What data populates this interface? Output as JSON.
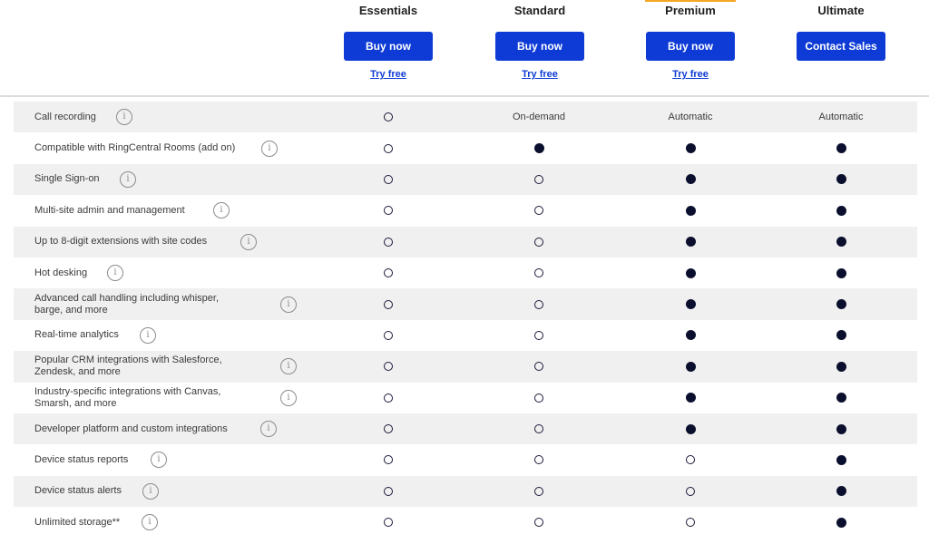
{
  "plans": [
    {
      "name": "Essentials",
      "button": "Buy now",
      "try": "Try free",
      "accent": false
    },
    {
      "name": "Standard",
      "button": "Buy now",
      "try": "Try free",
      "accent": false
    },
    {
      "name": "Premium",
      "button": "Buy now",
      "try": "Try free",
      "accent": true
    },
    {
      "name": "Ultimate",
      "button": "Contact Sales",
      "try": "",
      "accent": false
    }
  ],
  "features": [
    {
      "label": "Call recording",
      "wrap": false,
      "values": [
        "empty",
        "On-demand",
        "Automatic",
        "Automatic"
      ]
    },
    {
      "label": "Compatible with RingCentral Rooms (add on)",
      "wrap": false,
      "values": [
        "empty",
        "full",
        "full",
        "full"
      ]
    },
    {
      "label": "Single Sign-on",
      "wrap": false,
      "values": [
        "empty",
        "empty",
        "full",
        "full"
      ]
    },
    {
      "label": "Multi-site admin and management",
      "wrap": false,
      "values": [
        "empty",
        "empty",
        "full",
        "full"
      ]
    },
    {
      "label": "Up to 8-digit extensions with site codes",
      "wrap": false,
      "values": [
        "empty",
        "empty",
        "full",
        "full"
      ]
    },
    {
      "label": "Hot desking",
      "wrap": false,
      "values": [
        "empty",
        "empty",
        "full",
        "full"
      ]
    },
    {
      "label": "Advanced call handling including whisper, barge, and more",
      "wrap": true,
      "values": [
        "empty",
        "empty",
        "full",
        "full"
      ]
    },
    {
      "label": "Real-time analytics",
      "wrap": false,
      "values": [
        "empty",
        "empty",
        "full",
        "full"
      ]
    },
    {
      "label": "Popular CRM integrations with Salesforce, Zendesk, and more",
      "wrap": true,
      "values": [
        "empty",
        "empty",
        "full",
        "full"
      ]
    },
    {
      "label": "Industry-specific integrations with Canvas, Smarsh, and more",
      "wrap": true,
      "values": [
        "empty",
        "empty",
        "full",
        "full"
      ]
    },
    {
      "label": "Developer platform and custom integrations",
      "wrap": false,
      "values": [
        "empty",
        "empty",
        "full",
        "full"
      ]
    },
    {
      "label": "Device status reports",
      "wrap": false,
      "values": [
        "empty",
        "empty",
        "empty",
        "full"
      ]
    },
    {
      "label": "Device status alerts",
      "wrap": false,
      "values": [
        "empty",
        "empty",
        "empty",
        "full"
      ]
    },
    {
      "label": "Unlimited storage**",
      "wrap": false,
      "values": [
        "empty",
        "empty",
        "empty",
        "full"
      ]
    }
  ],
  "info_icon": "info-icon",
  "colors": {
    "button": "#0e3bd6",
    "link": "#0e3bd6",
    "shade": "#f1f0f0",
    "dot": "#0b0f2e",
    "accent": "#f5a623"
  }
}
